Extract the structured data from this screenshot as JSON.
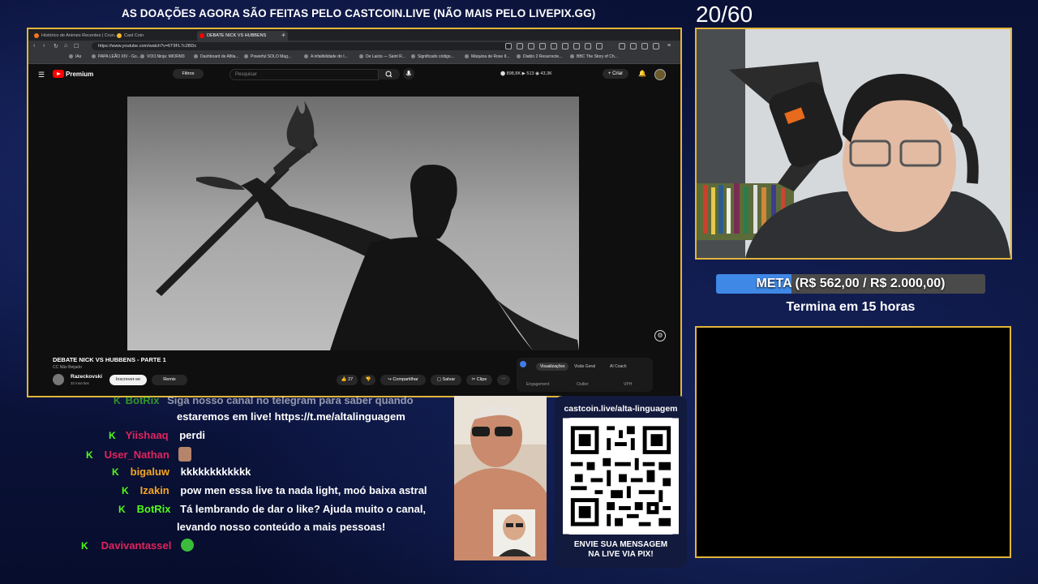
{
  "banner": "AS DOAÇÕES AGORA SÃO FEITAS PELO CASTCOIN.LIVE (NÃO MAIS PELO LIVEPIX.GG)",
  "counter": "20/60",
  "browser": {
    "tabs": [
      {
        "label": "Histórico de Animes Recentes | Crun...",
        "color": "#f47521"
      },
      {
        "label": "Cast Coin",
        "color": "#f7b731"
      },
      {
        "label": "DEBATE NICK VS HUBBENS",
        "color": "#ff0000",
        "active": true
      }
    ],
    "url": "https://www.youtube.com/watch?v=6T9FL7c2BDc",
    "bookmarks": [
      "IAs",
      "PAPA LEÃO XIV - Go...",
      "VOO.Ninja: MIORM3",
      "Dashboard de Afilia...",
      "Powerful SOLO Mag...",
      "A infalibilidade do I...",
      "De Laicis — Saint R...",
      "Significado código...",
      "Máquina de Rose Il...",
      "Diablo 2 Resurrecte...",
      "BBC The Story of Ch..."
    ]
  },
  "youtube": {
    "logo": "Premium",
    "filtros": "Filtros",
    "search_placeholder": "Pesquisar",
    "stats": "⬤ 898,8K  ▶ 513  ◉ 43,3K",
    "criar": "+ Criar",
    "video_title": "DEBATE NICK VS HUBBENS - PARTE 1",
    "cc": "CC Não Beijado",
    "channel": "Razeckovski",
    "channel_subs": "32 inscritos",
    "subscribe": "Inscrever-se",
    "remix": "Remix",
    "likes": "27",
    "share": "Compartilhar",
    "save": "Salvar",
    "clip": "Clipe",
    "panel_tabs": [
      "Visualizações",
      "Visão Geral",
      "AI Coach"
    ],
    "panel_labels": [
      "Engagement",
      "Outlier",
      "VPH"
    ]
  },
  "meta": {
    "text": "META (R$ 562,00 / R$ 2.000,00)",
    "progress": 0.281
  },
  "termina": "Termina em 15 horas",
  "chat": [
    {
      "user": "BotRix",
      "color": "#53fc18",
      "msg": "Siga nosso canal no telegram para saber quando"
    },
    {
      "user": "",
      "color": "#53fc18",
      "msg": "estaremos em live! https://t.me/altalinguagem"
    },
    {
      "user": "Yiishaaq",
      "color": "#e0245e",
      "msg": "perdi"
    },
    {
      "user": "User_Nathan",
      "color": "#e0245e",
      "msg": ""
    },
    {
      "user": "bigaluw",
      "color": "#f5a623",
      "msg": "kkkkkkkkkkkk"
    },
    {
      "user": "Izakin",
      "color": "#f5a623",
      "msg": "pow men essa live ta nada light, moó baixa astral"
    },
    {
      "user": "BotRix",
      "color": "#53fc18",
      "msg": "Tá lembrando de dar o like? Ajuda muito o canal,"
    },
    {
      "user": "",
      "color": "#53fc18",
      "msg": "levando nosso conteúdo a mais pessoas!"
    },
    {
      "user": "Davivantassel",
      "color": "#e0245e",
      "msg": ""
    }
  ],
  "qr": {
    "url": "castcoin.live/alta-linguagem",
    "line1": "ENVIE SUA MENSAGEM",
    "line2": "NA LIVE VIA PIX!"
  }
}
